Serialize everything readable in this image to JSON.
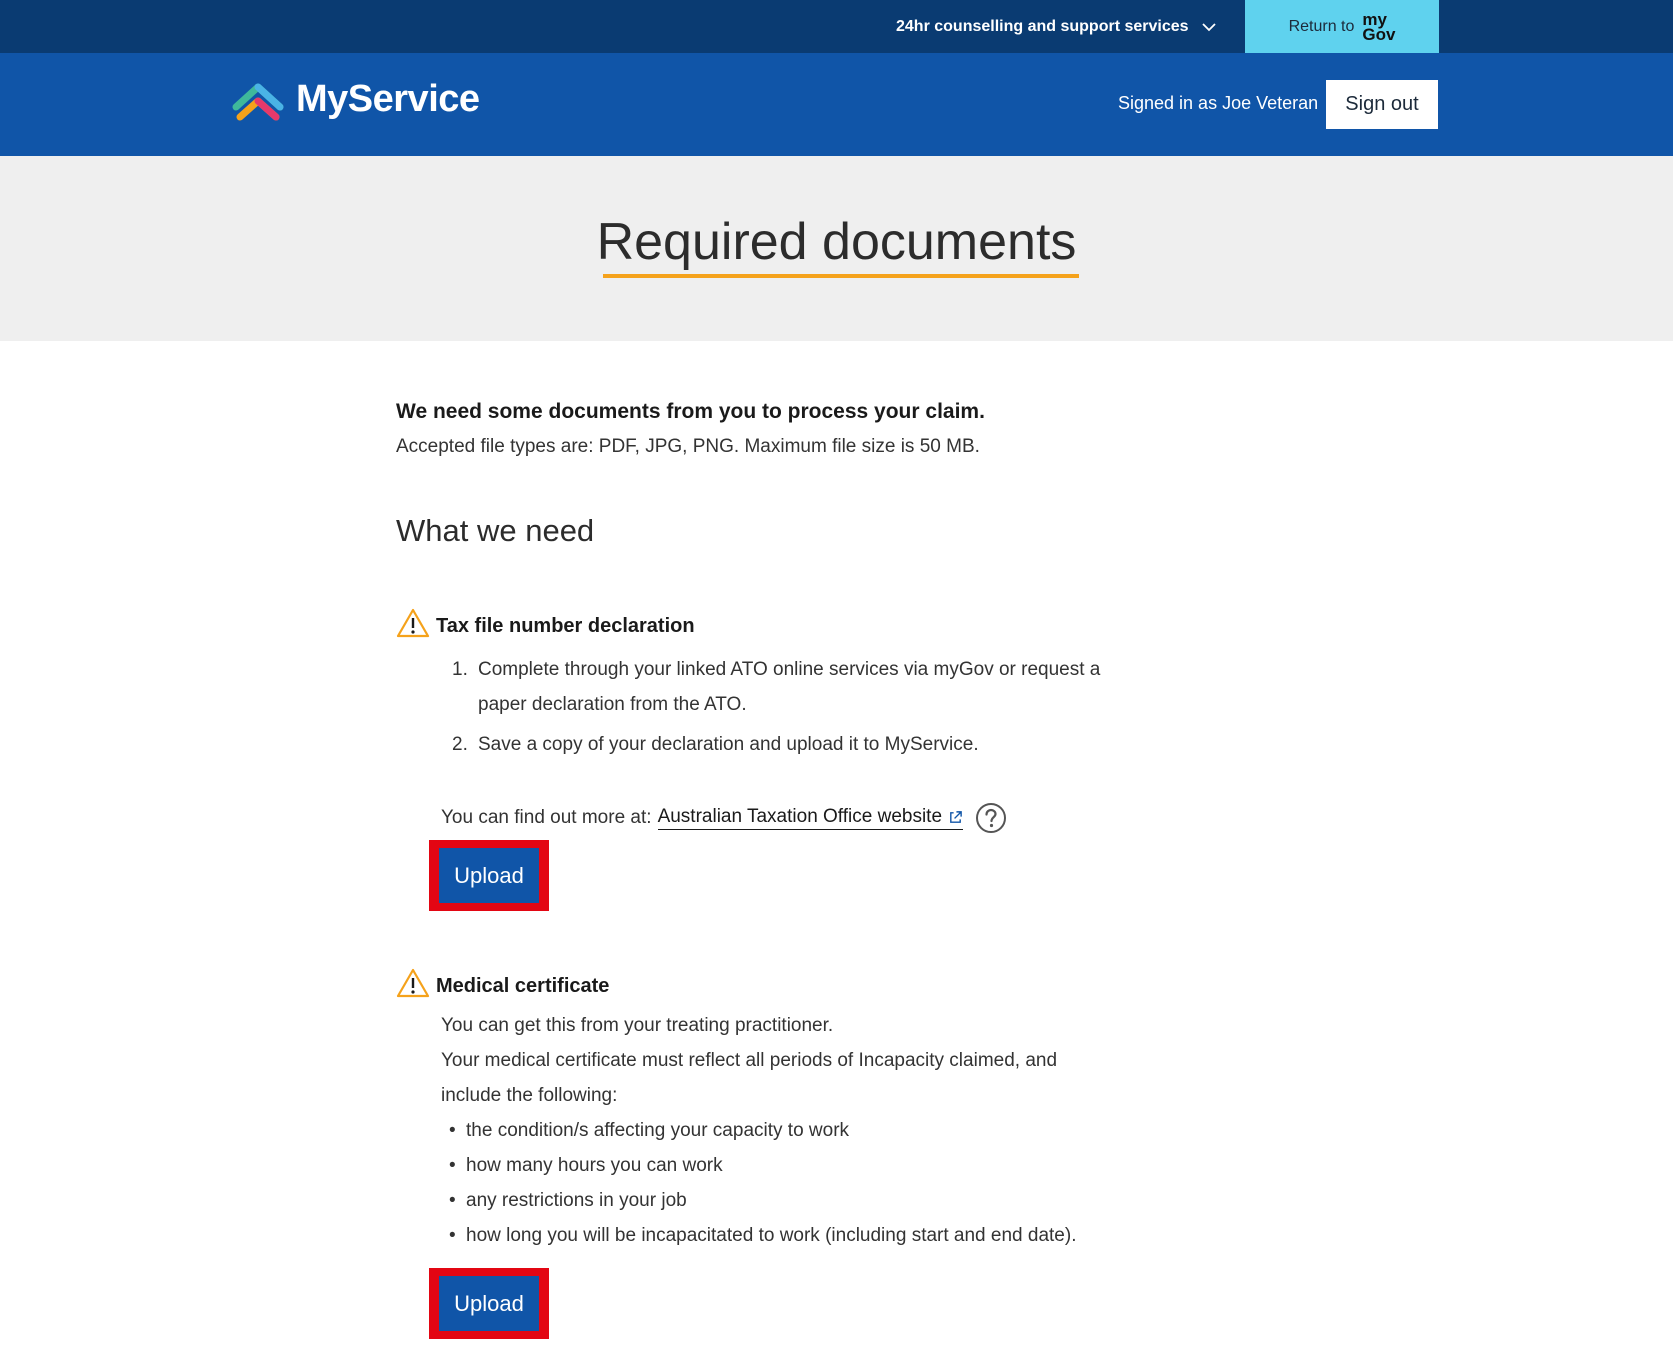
{
  "topbar": {
    "support_label": "24hr counselling and support services",
    "mygov_prefix": "Return to",
    "mygov_logo_top": "my",
    "mygov_logo_bottom": "Gov"
  },
  "header": {
    "logo_text": "MyService",
    "signed_in": "Signed in as Joe Veteran",
    "sign_out": "Sign out"
  },
  "hero": {
    "title": "Required documents"
  },
  "intro": {
    "lead": "We need some documents from you to process your claim.",
    "file_types": "Accepted file types are: PDF, JPG, PNG. Maximum file size is 50 MB."
  },
  "section_title": "What we need",
  "tax": {
    "title": "Tax file number declaration",
    "steps": [
      {
        "num": "1.",
        "line1": "Complete through your linked ATO online services via myGov or request a",
        "line2": "paper declaration from the ATO."
      },
      {
        "num": "2.",
        "line1": "Save a copy of your declaration and upload it to MyService."
      }
    ],
    "more_prefix": "You can find out more at:",
    "link_text": "Australian Taxation Office website",
    "upload_label": "Upload"
  },
  "medical": {
    "title": "Medical certificate",
    "line1": "You can get this from your treating practitioner.",
    "line2": "Your medical certificate must reflect all periods of Incapacity claimed, and",
    "line3": "include the following:",
    "bullets": [
      "the condition/s affecting your capacity to work",
      "how many hours you can work",
      "any restrictions in your job",
      "how long you will be incapacitated to work (including start and end date)."
    ],
    "upload_label": "Upload"
  },
  "colors": {
    "topbar": "#0a3b72",
    "header": "#1055a8",
    "mygov_button": "#5fd2ee",
    "accent_underline": "#f5a21b",
    "warning": "#f5a21b",
    "highlight": "#e30613"
  }
}
